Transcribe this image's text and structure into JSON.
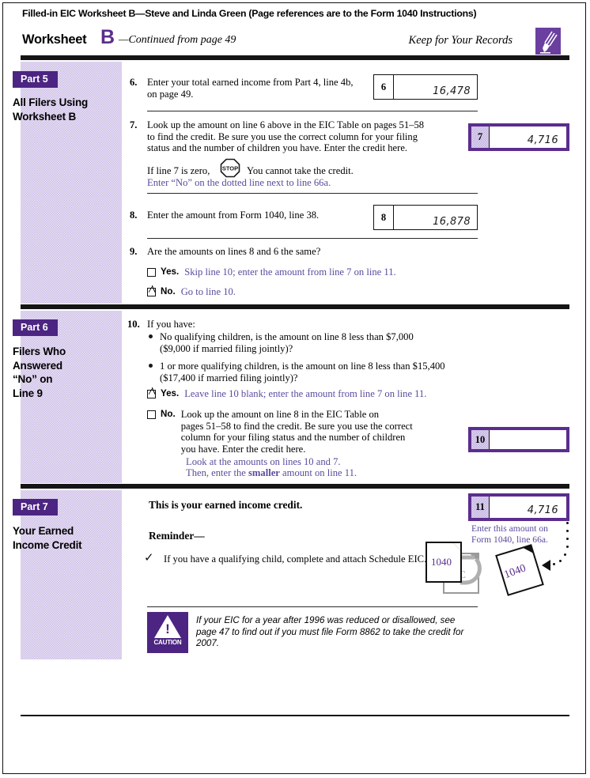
{
  "header": {
    "title": "Filled-in EIC Worksheet B—Steve and Linda Green (Page references are to the Form 1040 Instructions)",
    "worksheet_word": "Worksheet",
    "worksheet_letter": "B",
    "continued": "—Continued from page 49",
    "keep_note": "Keep for Your Records",
    "pen_icon": "pen-icon"
  },
  "part5": {
    "badge": "Part 5",
    "title": "All Filers Using\nWorksheet B",
    "line6": {
      "number": "6.",
      "text": "Enter your total earned income from Part 4, line 4b,\non page 49.",
      "box_label": "6",
      "value": "16,478"
    },
    "line7": {
      "number": "7.",
      "text": "Look up the amount on line 6 above in the EIC Table on pages 51–58\nto find the credit. Be sure you use the correct column for your filing\nstatus and the number of children you have. Enter the credit here.",
      "box_label": "7",
      "value": "4,716",
      "stop_text_before": "If line 7 is zero,",
      "stop_icon": "STOP",
      "stop_text_after": "You cannot take the credit.",
      "stop_instruction": "Enter “No” on the dotted line next to line 66a."
    },
    "line8": {
      "number": "8.",
      "text": "Enter the amount from Form 1040, line 38.",
      "box_label": "8",
      "value": "16,878"
    },
    "line9": {
      "number": "9.",
      "text": "Are the amounts on lines 8 and 6 the same?",
      "yes": {
        "label": "Yes.",
        "text": "Skip line 10; enter the amount from line 7 on line 11.",
        "checked": false
      },
      "no": {
        "label": "No.",
        "text": "Go to line 10.",
        "checked": true
      }
    }
  },
  "part6": {
    "badge": "Part 6",
    "title": "Filers Who\nAnswered\n“No” on\nLine 9",
    "line10": {
      "number": "10.",
      "intro": "If you have:",
      "bullet1": "No qualifying children, is the amount on line 8 less than $7,000\n($9,000 if married filing jointly)?",
      "bullet2": "1 or more qualifying children, is the amount on line 8 less than $15,400\n($17,400 if married filing jointly)?",
      "yes": {
        "label": "Yes.",
        "text": "Leave line 10 blank; enter the amount from line 7 on line 11.",
        "checked": true
      },
      "no": {
        "label": "No.",
        "text": "Look up the amount on line 8 in the EIC Table on\npages 51–58 to find the credit. Be sure you use the correct\ncolumn for your filing status and the number of children\nyou have. Enter the credit here.",
        "instruction1": "Look at the amounts on lines 10 and 7.",
        "instruction2_pre": "Then, enter the ",
        "instruction2_bold": "smaller",
        "instruction2_post": " amount on line 11.",
        "checked": false
      },
      "box_label": "10",
      "value": ""
    }
  },
  "part7": {
    "badge": "Part 7",
    "title": "Your Earned\nIncome Credit",
    "line11": {
      "text": "This is your earned income credit.",
      "box_label": "11",
      "value": "4,716",
      "note": "Enter this amount on\nForm 1040, line 66a."
    },
    "reminder": {
      "heading": "Reminder—",
      "check_glyph": "✓",
      "text": "If you have a qualifying child, complete and attach Schedule EIC.",
      "doc_1040_label": "1040",
      "doc_eic_label": "EIC",
      "doc_1040_tilted_label": "1040"
    },
    "caution": {
      "icon_word": "CAUTION",
      "text": "If your EIC for a year after 1996 was reduced or disallowed, see\npage 47 to find out if you must file Form 8862 to take the credit for\n2007."
    }
  },
  "colors": {
    "deep_purple": "#4C2582",
    "badge_purple": "#5B2D8E",
    "instruction_purple": "#5B4A9E",
    "shade_lavender": "#C9B9E4",
    "rule_black": "#151515"
  }
}
